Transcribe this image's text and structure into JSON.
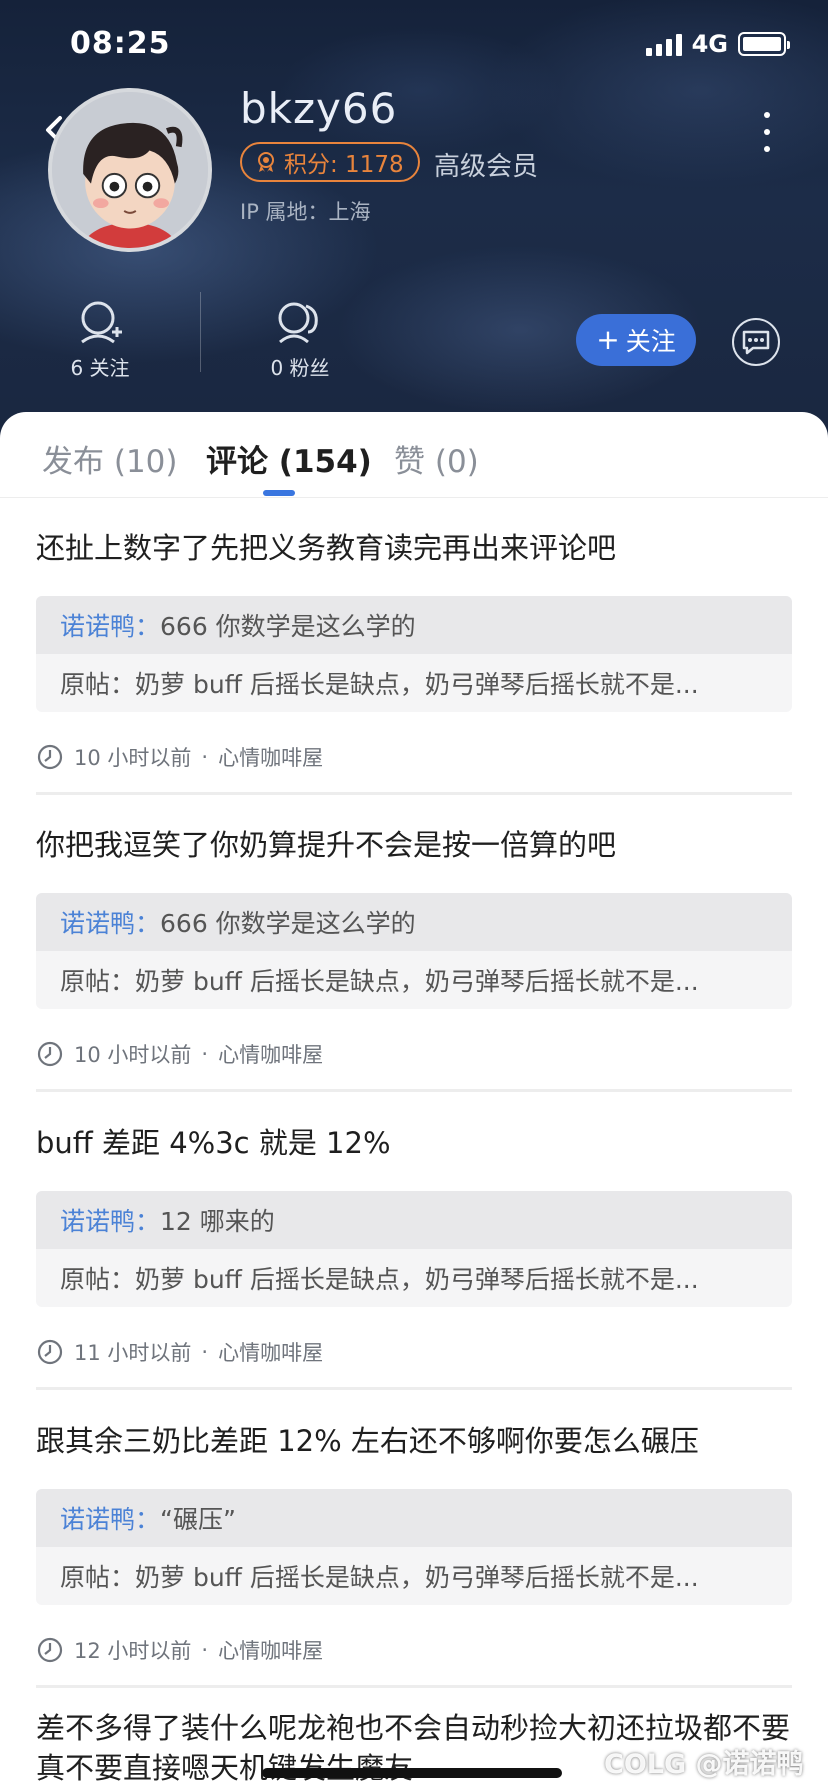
{
  "status_bar": {
    "time": "08:25",
    "network": "4G"
  },
  "profile": {
    "username": "bkzy66",
    "points_label": "积分: 1178",
    "member_level": "高级会员",
    "ip_location": "IP 属地：上海"
  },
  "stats": {
    "following": "6 关注",
    "fans": "0 粉丝"
  },
  "actions": {
    "follow_label": "关注",
    "follow_plus": "+"
  },
  "tabs": [
    {
      "label": "发布 (10)",
      "active": false
    },
    {
      "label": "评论 (154)",
      "active": true
    },
    {
      "label": "赞 (0)",
      "active": false
    }
  ],
  "comments": [
    {
      "text": "还扯上数字了先把义务教育读完再出来评论吧",
      "reply_author": "诺诺鸭：",
      "reply_text": "666 你数学是这么学的",
      "original_post": "原帖：奶萝 buff 后摇长是缺点，奶弓弹琴后摇长就不是...",
      "time": "10 小时以前",
      "board": "心情咖啡屋"
    },
    {
      "text": "你把我逗笑了你奶算提升不会是按一倍算的吧",
      "reply_author": "诺诺鸭：",
      "reply_text": "666 你数学是这么学的",
      "original_post": "原帖：奶萝 buff 后摇长是缺点，奶弓弹琴后摇长就不是...",
      "time": "10 小时以前",
      "board": "心情咖啡屋"
    },
    {
      "text": "buff 差距 4%3c 就是 12%",
      "reply_author": "诺诺鸭：",
      "reply_text": "12 哪来的",
      "original_post": "原帖：奶萝 buff 后摇长是缺点，奶弓弹琴后摇长就不是...",
      "time": "11 小时以前",
      "board": "心情咖啡屋"
    },
    {
      "text": "跟其余三奶比差距 12% 左右还不够啊你要怎么碾压",
      "reply_author": "诺诺鸭：",
      "reply_text": "“碾压”",
      "original_post": "原帖：奶萝 buff 后摇长是缺点，奶弓弹琴后摇长就不是...",
      "time": "12 小时以前",
      "board": "心情咖啡屋"
    }
  ],
  "meta_separator": "·",
  "last_comment_text": "差不多得了装什么呢龙袍也不会自动秒捡大初还拉圾都不要真不要直接嗯天机键发生魔友",
  "watermark": "COLG @诺诺鸭",
  "colors": {
    "accent_blue": "#3a6fd8",
    "points_orange": "#e8843c",
    "reply_author_blue": "#4b82d6"
  }
}
